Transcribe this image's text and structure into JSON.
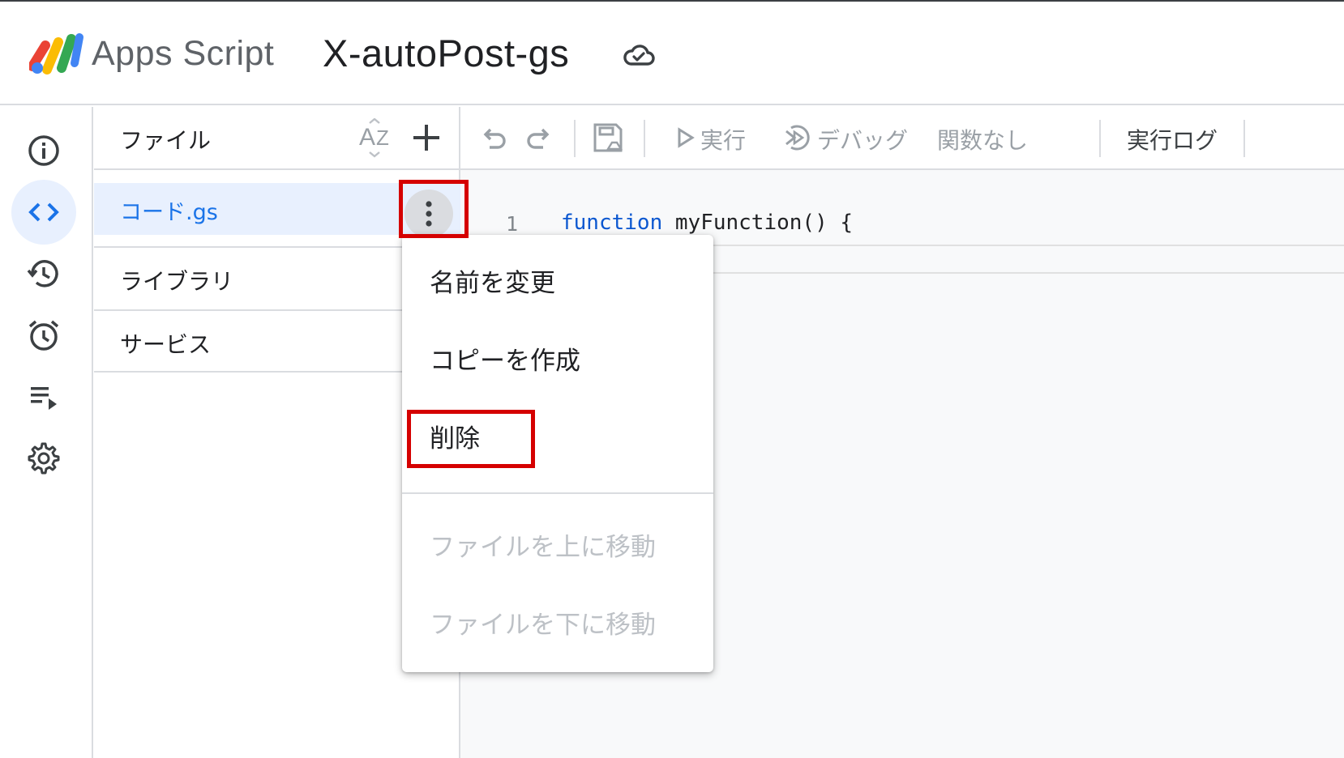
{
  "header": {
    "app_name": "Apps Script",
    "project_name": "X-autoPost-gs"
  },
  "sidebar": {
    "items": [
      {
        "name": "overview",
        "icon": "info-icon",
        "active": false
      },
      {
        "name": "editor",
        "icon": "code-icon",
        "active": true
      },
      {
        "name": "history",
        "icon": "history-icon",
        "active": false
      },
      {
        "name": "triggers",
        "icon": "alarm-icon",
        "active": false
      },
      {
        "name": "executions",
        "icon": "playlist-play-icon",
        "active": false
      },
      {
        "name": "settings",
        "icon": "gear-icon",
        "active": false
      }
    ]
  },
  "files_panel": {
    "title": "ファイル",
    "files": [
      {
        "name": "コード.gs",
        "selected": true
      }
    ],
    "sections": [
      "ライブラリ",
      "サービス"
    ]
  },
  "toolbar": {
    "run_label": "実行",
    "debug_label": "デバッグ",
    "function_select": "関数なし",
    "log_label": "実行ログ"
  },
  "editor": {
    "lines": [
      {
        "number": "1",
        "keyword": "function",
        "rest": " myFunction() {"
      }
    ]
  },
  "context_menu": {
    "items": [
      {
        "label": "名前を変更",
        "enabled": true
      },
      {
        "label": "コピーを作成",
        "enabled": true
      },
      {
        "label": "削除",
        "enabled": true
      },
      {
        "label": "ファイルを上に移動",
        "enabled": false
      },
      {
        "label": "ファイルを下に移動",
        "enabled": false
      }
    ]
  },
  "colors": {
    "accent": "#1a73e8",
    "highlight_box": "#d50000",
    "selected_bg": "#e8f0fe",
    "disabled_text": "#bdc1c6"
  }
}
